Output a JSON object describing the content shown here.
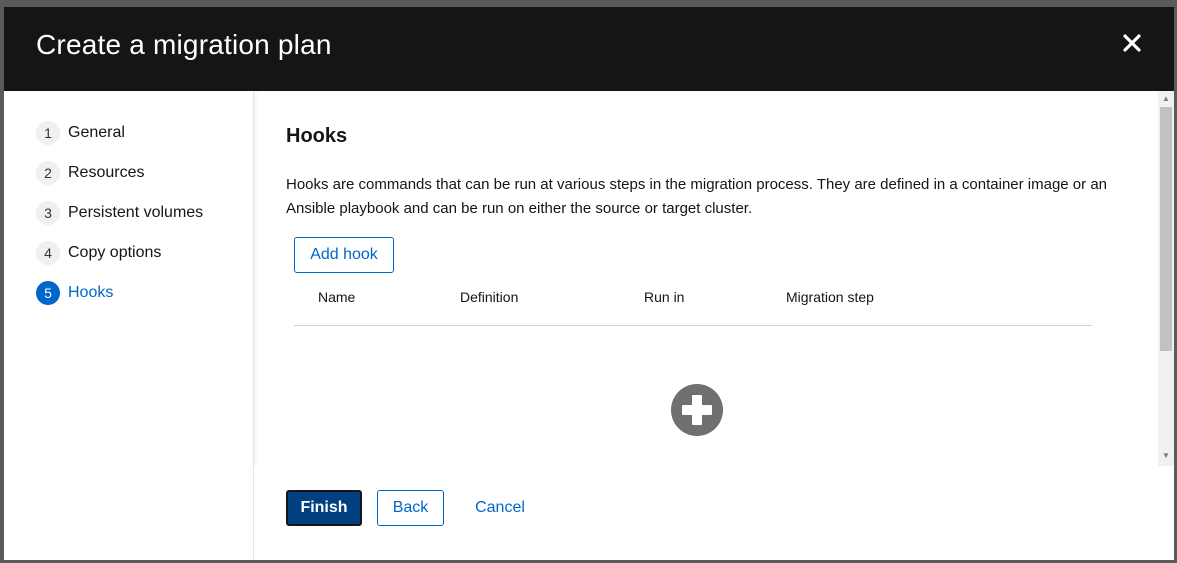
{
  "header": {
    "title": "Create a migration plan",
    "close_icon": "close-icon"
  },
  "nav": {
    "items": [
      {
        "num": "1",
        "label": "General"
      },
      {
        "num": "2",
        "label": "Resources"
      },
      {
        "num": "3",
        "label": "Persistent volumes"
      },
      {
        "num": "4",
        "label": "Copy options"
      },
      {
        "num": "5",
        "label": "Hooks",
        "active": true
      }
    ]
  },
  "content": {
    "title": "Hooks",
    "description": "Hooks are commands that can be run at various steps in the migration process. They are defined in a container image or an Ansible playbook and can be run on either the source or target cluster.",
    "add_hook_label": "Add hook",
    "table": {
      "columns": [
        "Name",
        "Definition",
        "Run in",
        "Migration step"
      ],
      "rows": []
    },
    "empty_state_icon": "plus-circle-icon"
  },
  "footer": {
    "finish_label": "Finish",
    "back_label": "Back",
    "cancel_label": "Cancel"
  },
  "colors": {
    "header_bg": "#151515",
    "accent": "#0066cc",
    "primary_button": "#004080"
  }
}
